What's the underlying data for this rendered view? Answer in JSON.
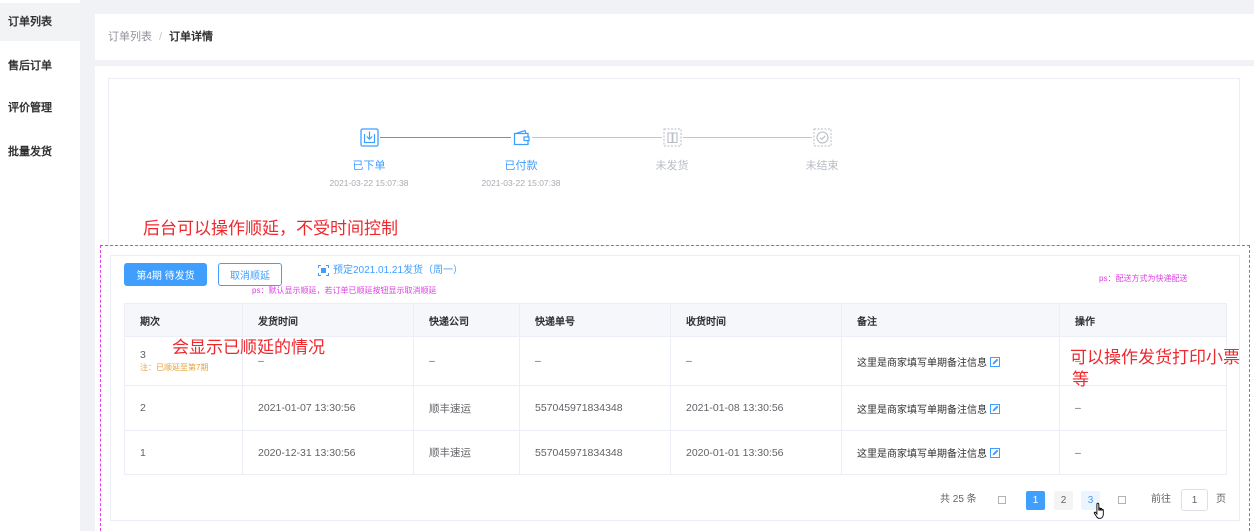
{
  "sidebar": {
    "items": [
      {
        "label": "订单列表",
        "active": true
      },
      {
        "label": "售后订单",
        "active": false
      },
      {
        "label": "评价管理",
        "active": false
      },
      {
        "label": "批量发货",
        "active": false
      }
    ]
  },
  "breadcrumb": {
    "parent": "订单列表",
    "separator": "/",
    "current": "订单详情"
  },
  "steps": [
    {
      "label": "已下单",
      "time": "2021-03-22 15:07:38",
      "status": "done",
      "icon": "order-download-icon"
    },
    {
      "label": "已付款",
      "time": "2021-03-22 15:07:38",
      "status": "done",
      "icon": "wallet-icon"
    },
    {
      "label": "未发货",
      "status": "pending",
      "icon": "shipment-box-icon"
    },
    {
      "label": "未结束",
      "status": "pending",
      "icon": "check-circle-icon"
    }
  ],
  "annotations": {
    "postpone": "后台可以操作顺延，不受时间控制",
    "row_postponed": "会显示已顺延的情况",
    "actions": [
      "可以操作发货打印小票",
      "等"
    ]
  },
  "toolbar": {
    "ship_button": "第4期 待发货",
    "cancel_postpone_button": "取消顺延",
    "scheduled": "预定2021.01.21发货（周一）",
    "ps_left": "ps：默认显示顺延，若订单已顺延按钮显示取消顺延",
    "ps_right": "ps：配送方式为快递配送"
  },
  "table": {
    "columns": [
      "期次",
      "发货时间",
      "快递公司",
      "快递单号",
      "收货时间",
      "备注",
      "操作"
    ],
    "rows": [
      {
        "period": "3",
        "note": "注：已顺延至第7期",
        "ship_time": "–",
        "courier": "–",
        "tracking": "–",
        "receive_time": "–",
        "remark": "这里是商家填写单期备注信息",
        "action": "–"
      },
      {
        "period": "2",
        "ship_time": "2021-01-07 13:30:56",
        "courier": "顺丰速运",
        "tracking": "557045971834348",
        "receive_time": "2021-01-08 13:30:56",
        "remark": "这里是商家填写单期备注信息",
        "action": "–"
      },
      {
        "period": "1",
        "ship_time": "2020-12-31 13:30:56",
        "courier": "顺丰速运",
        "tracking": "557045971834348",
        "receive_time": "2020-01-01 13:30:56",
        "remark": "这里是商家填写单期备注信息",
        "action": "–"
      }
    ]
  },
  "pagination": {
    "total": "共 25 条",
    "pages": [
      {
        "label": "1",
        "active": true
      },
      {
        "label": "2"
      },
      {
        "label": "3",
        "hover": true
      }
    ],
    "goto_label": "前往",
    "goto_value": "1",
    "page_suffix": "页"
  },
  "colors": {
    "accent": "#409eff",
    "annotation": "#f0272d",
    "markup": "#e03ee6",
    "note": "#e6a23c"
  }
}
